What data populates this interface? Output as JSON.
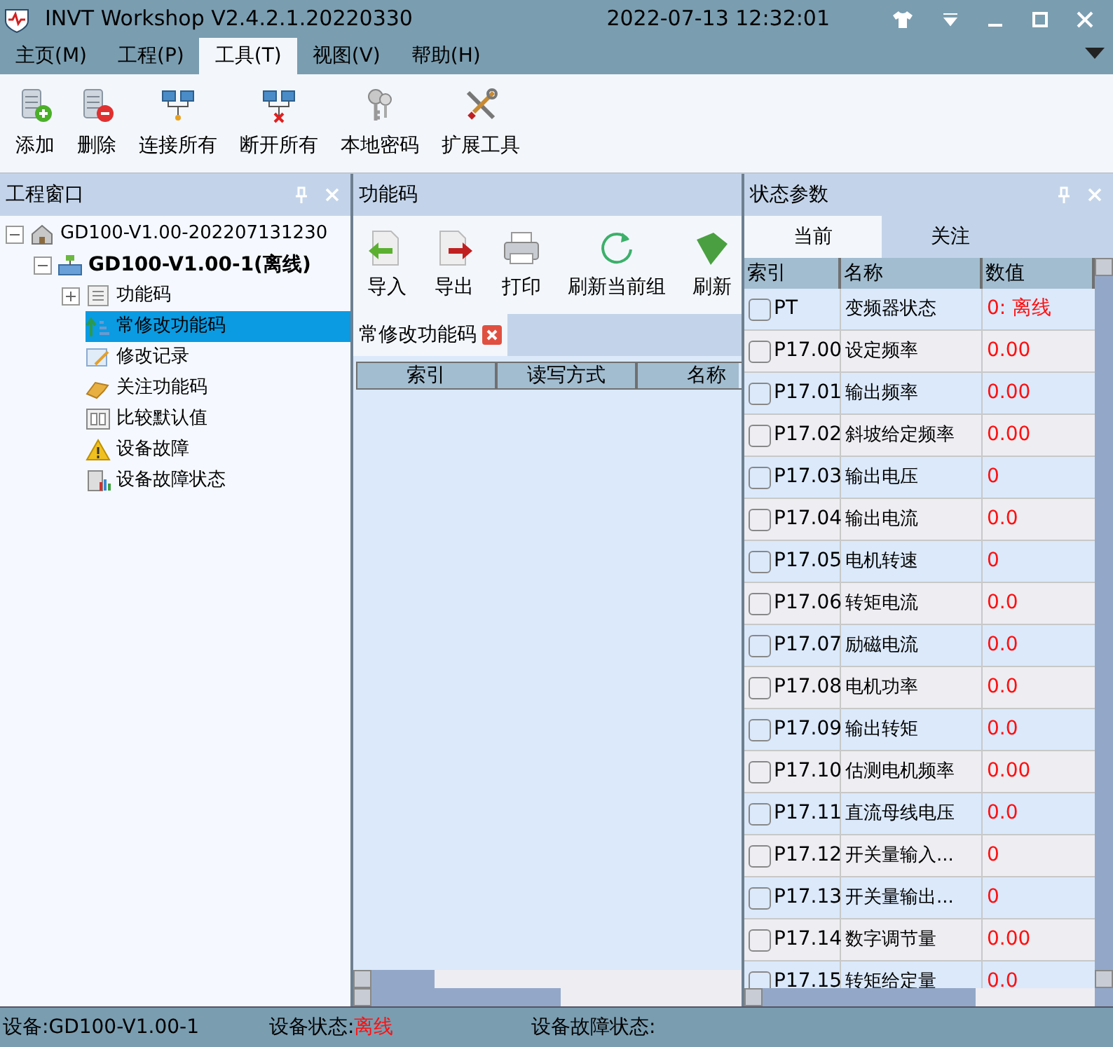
{
  "window": {
    "title": "INVT Workshop V2.4.2.1.20220330",
    "datetime": "2022-07-13 12:32:01"
  },
  "menu": [
    {
      "label": "主页(M)",
      "selected": false
    },
    {
      "label": "工程(P)",
      "selected": false
    },
    {
      "label": "工具(T)",
      "selected": true
    },
    {
      "label": "视图(V)",
      "selected": false
    },
    {
      "label": "帮助(H)",
      "selected": false
    }
  ],
  "toolbar": [
    {
      "label": "添加",
      "kind": "add"
    },
    {
      "label": "删除",
      "kind": "remove"
    },
    {
      "label": "连接所有",
      "kind": "connect"
    },
    {
      "label": "断开所有",
      "kind": "disconnect"
    },
    {
      "label": "本地密码",
      "kind": "keys"
    },
    {
      "label": "扩展工具",
      "kind": "tools"
    }
  ],
  "project_panel": {
    "title": "工程窗口",
    "tree": [
      {
        "label": "GD100-V1.00-202207131230",
        "kind": "project",
        "expanded": true,
        "selected": false,
        "children": [
          {
            "label": "GD100-V1.00-1(离线)",
            "kind": "device",
            "expanded": true,
            "selected": false,
            "children": [
              {
                "label": "功能码",
                "kind": "list",
                "expanded": false,
                "selected": false
              },
              {
                "label": "常修改功能码",
                "kind": "frequent",
                "selected": true
              },
              {
                "label": "修改记录",
                "kind": "record",
                "selected": false
              },
              {
                "label": "关注功能码",
                "kind": "follow",
                "selected": false
              },
              {
                "label": "比较默认值",
                "kind": "compare",
                "selected": false
              },
              {
                "label": "设备故障",
                "kind": "warning",
                "selected": false
              },
              {
                "label": "设备故障状态",
                "kind": "report",
                "selected": false
              }
            ]
          }
        ]
      }
    ]
  },
  "function_panel": {
    "title": "功能码",
    "toolbar": [
      {
        "label": "导入",
        "kind": "import"
      },
      {
        "label": "导出",
        "kind": "export"
      },
      {
        "label": "打印",
        "kind": "print"
      },
      {
        "label": "刷新当前组",
        "kind": "refresh"
      },
      {
        "label": "刷新",
        "kind": "refresh-all"
      }
    ],
    "tab": "常修改功能码",
    "columns": [
      "索引",
      "读写方式",
      "名称"
    ]
  },
  "status_panel": {
    "title": "状态参数",
    "tabs": [
      {
        "label": "当前",
        "selected": true
      },
      {
        "label": "关注",
        "selected": false
      }
    ],
    "columns": [
      "索引",
      "名称",
      "数值"
    ],
    "rows": [
      {
        "index": "PT",
        "name": "变频器状态",
        "value": "0: 离线",
        "checked": false
      },
      {
        "index": "P17.00",
        "name": "设定频率",
        "value": "0.00",
        "checked": false
      },
      {
        "index": "P17.01",
        "name": "输出频率",
        "value": "0.00",
        "checked": false
      },
      {
        "index": "P17.02",
        "name": "斜坡给定频率",
        "value": "0.00",
        "checked": false
      },
      {
        "index": "P17.03",
        "name": "输出电压",
        "value": "0",
        "checked": false
      },
      {
        "index": "P17.04",
        "name": "输出电流",
        "value": "0.0",
        "checked": false
      },
      {
        "index": "P17.05",
        "name": "电机转速",
        "value": "0",
        "checked": false
      },
      {
        "index": "P17.06",
        "name": "转矩电流",
        "value": "0.0",
        "checked": false
      },
      {
        "index": "P17.07",
        "name": "励磁电流",
        "value": "0.0",
        "checked": false
      },
      {
        "index": "P17.08",
        "name": "电机功率",
        "value": "0.0",
        "checked": false
      },
      {
        "index": "P17.09",
        "name": "输出转矩",
        "value": "0.0",
        "checked": false
      },
      {
        "index": "P17.10",
        "name": "估测电机频率",
        "value": "0.00",
        "checked": false
      },
      {
        "index": "P17.11",
        "name": "直流母线电压",
        "value": "0.0",
        "checked": false
      },
      {
        "index": "P17.12",
        "name": "开关量输入...",
        "value": "0",
        "checked": false
      },
      {
        "index": "P17.13",
        "name": "开关量输出...",
        "value": "0",
        "checked": false
      },
      {
        "index": "P17.14",
        "name": "数字调节量",
        "value": "0.00",
        "checked": false
      },
      {
        "index": "P17.15",
        "name": "转矩给定量",
        "value": "0.0",
        "checked": false
      }
    ]
  },
  "status_bar": {
    "device": "设备:GD100-V1.00-1",
    "state_label": "设备状态:",
    "state_value": "离线",
    "fault_label": "设备故障状态:"
  }
}
